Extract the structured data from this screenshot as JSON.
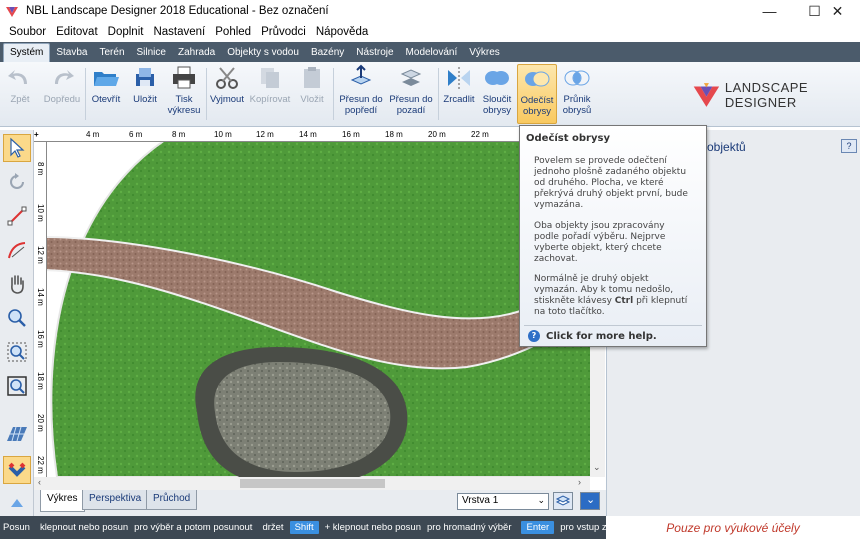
{
  "window": {
    "title": "NBL Landscape Designer 2018 Educational - Bez označení"
  },
  "menu": [
    "Soubor",
    "Editovat",
    "Doplnit",
    "Nastavení",
    "Pohled",
    "Průvodci",
    "Nápověda"
  ],
  "ribbon_tabs": [
    "Systém",
    "Stavba",
    "Terén",
    "Silnice",
    "Zahrada",
    "Objekty s vodou",
    "Bazény",
    "Nástroje",
    "Modelování",
    "Výkres"
  ],
  "toolbar": {
    "back": "Zpět",
    "forward": "Dopředu",
    "open": "Otevřít",
    "save": "Uložit",
    "print_1": "Tisk",
    "print_2": "výkresu",
    "cut": "Vyjmout",
    "copy": "Kopírovat",
    "paste": "Vložit",
    "front_1": "Přesun do",
    "front_2": "popředí",
    "back_1": "Přesun do",
    "back_2": "pozadí",
    "mirror": "Zrcadlit",
    "merge_1": "Sloučit",
    "merge_2": "obrysy",
    "subtract_1": "Odečíst",
    "subtract_2": "obrysy",
    "intersect_1": "Průnik",
    "intersect_2": "obrysů"
  },
  "brand": {
    "text": "LANDSCAPE DESIGNER",
    "color": "#e5484d"
  },
  "ruler": {
    "h": [
      "4 m",
      "6 m",
      "8 m",
      "10 m",
      "12 m",
      "14 m",
      "16 m",
      "18 m",
      "20 m",
      "22 m"
    ],
    "v": [
      "8 m",
      "10 m",
      "12 m",
      "14 m",
      "16 m",
      "18 m",
      "20 m",
      "22 m"
    ]
  },
  "bottom_tabs": [
    "Výkres",
    "Perspektiva",
    "Průchod"
  ],
  "layer": {
    "value": "Vrstva 1"
  },
  "right_panel": {
    "title": "objektů",
    "help": "?"
  },
  "tooltip": {
    "title": "Odečíst obrysy",
    "p1_l1": "Povelem se provede odečtení",
    "p1_l2": "jednoho plošně zadaného objektu",
    "p1_l3": "od druhého. Plocha, ve které",
    "p1_l4": "překrývá druhý objekt první, bude",
    "p1_l5": "vymazána.",
    "p2_l1": "Oba objekty jsou zpracovány",
    "p2_l2": "podle pořadí výběru. Nejprve",
    "p2_l3": "vyberte objekt, který chcete",
    "p2_l4": "zachovat.",
    "p3_l1": "Normálně je druhý objekt",
    "p3_l2": "vymazán. Aby k tomu nedošlo,",
    "p3_l3a": "stiskněte klávesy ",
    "p3_l3b": "Ctrl",
    "p3_l3c": " při klepnutí",
    "p3_l4": "na toto tlačítko.",
    "help": "Click for more help."
  },
  "status": {
    "s1": "Posun",
    "s2": "klepnout nebo posun",
    "s3": "pro výběr a potom posunout",
    "s4": "držet",
    "key_shift": "Shift",
    "s5": "+ klepnout nebo posun",
    "s6": "pro hromadný výběr",
    "key_enter": "Enter",
    "s7": "pro vstup z klá"
  },
  "edu_note": "Pouze pro výukové účely"
}
